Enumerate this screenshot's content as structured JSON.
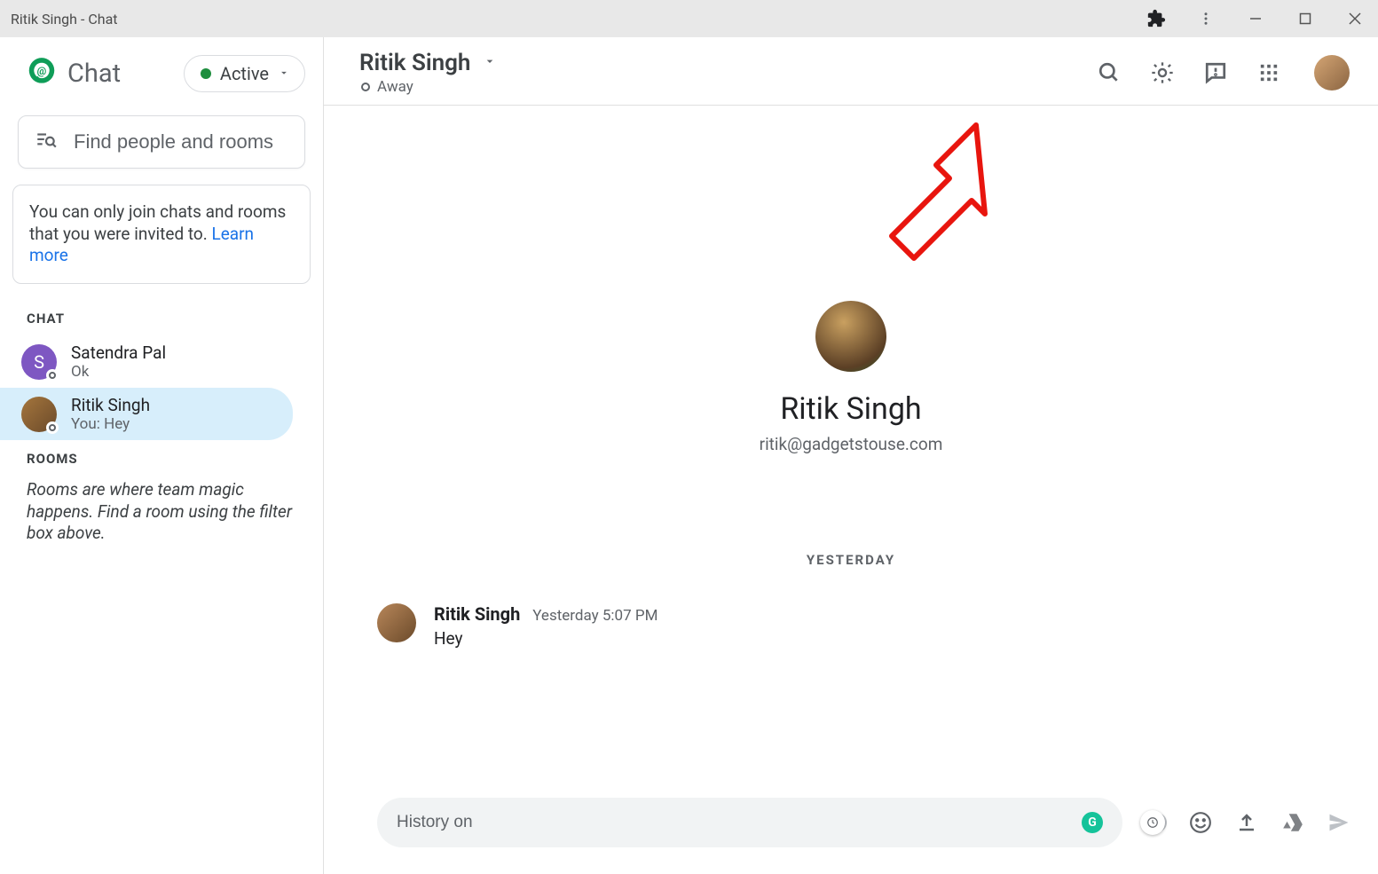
{
  "window": {
    "title": "Ritik Singh - Chat"
  },
  "brand": {
    "name": "Chat"
  },
  "status": {
    "label": "Active"
  },
  "search": {
    "placeholder": "Find people and rooms"
  },
  "info": {
    "text": "You can only join chats and rooms that you were invited to. ",
    "link": "Learn more"
  },
  "sections": {
    "chat": "CHAT",
    "rooms": "ROOMS"
  },
  "chats": [
    {
      "name": "Satendra Pal",
      "preview": "Ok",
      "initial": "S"
    },
    {
      "name": "Ritik Singh",
      "preview": "You: Hey"
    }
  ],
  "rooms_desc": "Rooms are where team magic happens. Find a room using the filter box above.",
  "conversation": {
    "title": "Ritik Singh",
    "status": "Away",
    "contact_name": "Ritik Singh",
    "contact_email": "ritik@gadgetstouse.com",
    "date_separator": "YESTERDAY",
    "message": {
      "sender": "Ritik Singh",
      "time": "Yesterday 5:07 PM",
      "text": "Hey"
    },
    "compose_placeholder": "History on"
  }
}
